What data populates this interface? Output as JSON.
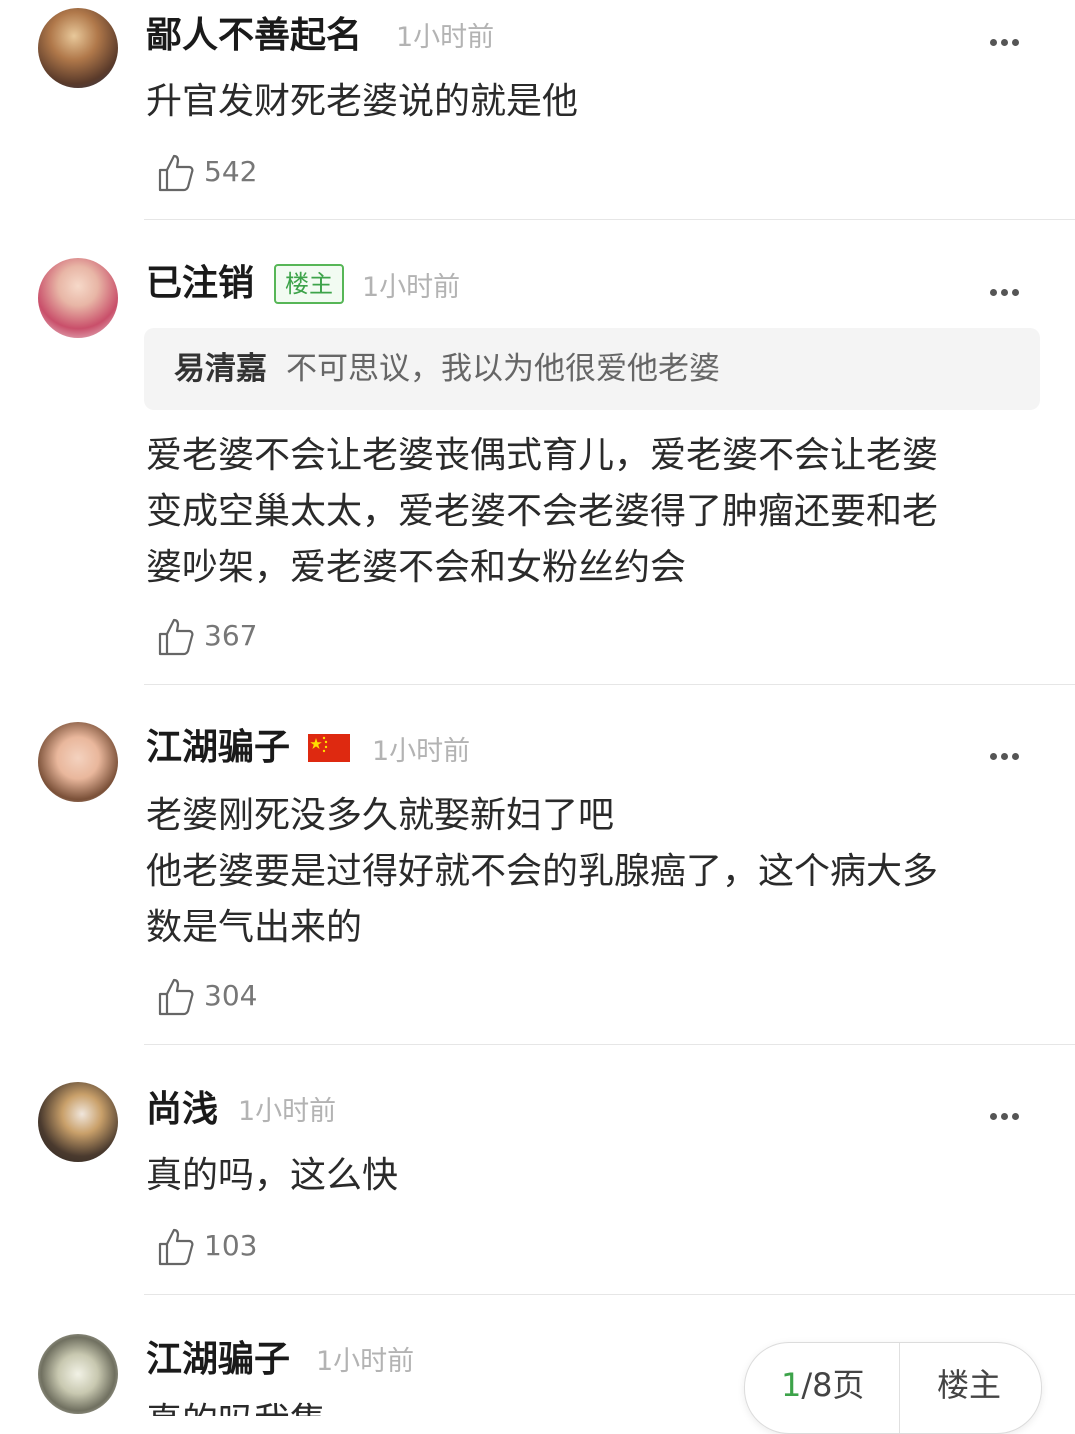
{
  "comments": [
    {
      "username": "鄙人不善起名",
      "time": "1小时前",
      "text": "升官发财死老婆说的就是他",
      "likes": "542"
    },
    {
      "username": "已注销",
      "badge": "楼主",
      "time": "1小时前",
      "quote": {
        "name": "易清嘉",
        "text": "不可思议，我以为他很爱他老婆"
      },
      "text": "爱老婆不会让老婆丧偶式育儿，爱老婆不会让老婆\n变成空巢太太，爱老婆不会老婆得了肿瘤还要和老\n婆吵架，爱老婆不会和女粉丝约会",
      "likes": "367"
    },
    {
      "username": "江湖骗子",
      "flag": "china-flag-icon",
      "time": "1小时前",
      "text": "老婆刚死没多久就娶新妇了吧\n他老婆要是过得好就不会的乳腺癌了，这个病大多\n数是气出来的",
      "likes": "304"
    },
    {
      "username": "尚浅",
      "time": "1小时前",
      "text": "真的吗，这么快",
      "likes": "103"
    },
    {
      "username": "江湖骗子",
      "time": "1小时前",
      "text": "真的吗我集"
    }
  ],
  "pager": {
    "current": "1",
    "total": "/8页",
    "host_label": "楼主"
  },
  "colors": {
    "accent": "#3da34a",
    "badge_border": "#57b657",
    "muted": "#b3b3b3"
  }
}
